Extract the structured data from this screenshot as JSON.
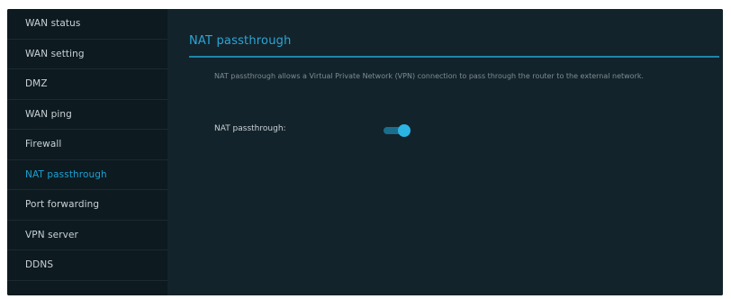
{
  "sidebar": {
    "items": [
      {
        "label": "WAN status"
      },
      {
        "label": "WAN setting"
      },
      {
        "label": "DMZ"
      },
      {
        "label": "WAN ping"
      },
      {
        "label": "Firewall"
      },
      {
        "label": "NAT passthrough"
      },
      {
        "label": "Port forwarding"
      },
      {
        "label": "VPN server"
      },
      {
        "label": "DDNS"
      }
    ],
    "active_index": 5
  },
  "main": {
    "title": "NAT passthrough",
    "description": "NAT passthrough allows a Virtual Private Network (VPN) connection to pass through the router to the external network.",
    "setting": {
      "label": "NAT passthrough:",
      "enabled": true
    }
  },
  "colors": {
    "accent": "#2aa6d6",
    "sidebar_bg": "#0d1a20",
    "main_bg": "#13232b",
    "toggle_on": "#2bb3e6"
  }
}
